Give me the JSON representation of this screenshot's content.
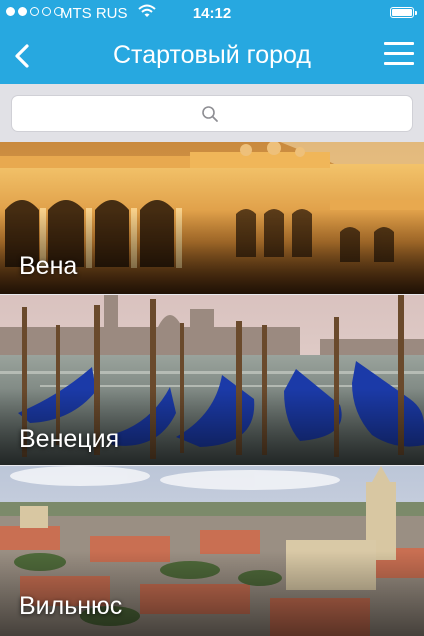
{
  "status_bar": {
    "carrier": "MTS RUS",
    "time": "14:12",
    "signal_bars_filled": 2,
    "signal_bars_total": 5
  },
  "nav": {
    "title": "Стартовый город",
    "back_icon": "chevron-left-icon",
    "menu_icon": "hamburger-menu-icon"
  },
  "search": {
    "placeholder": "",
    "icon": "search-icon"
  },
  "cities": [
    {
      "name": "Вена"
    },
    {
      "name": "Венеция"
    },
    {
      "name": "Вильнюс"
    }
  ],
  "colors": {
    "accent": "#27a8e0",
    "search_background": "#e1e1e6"
  }
}
